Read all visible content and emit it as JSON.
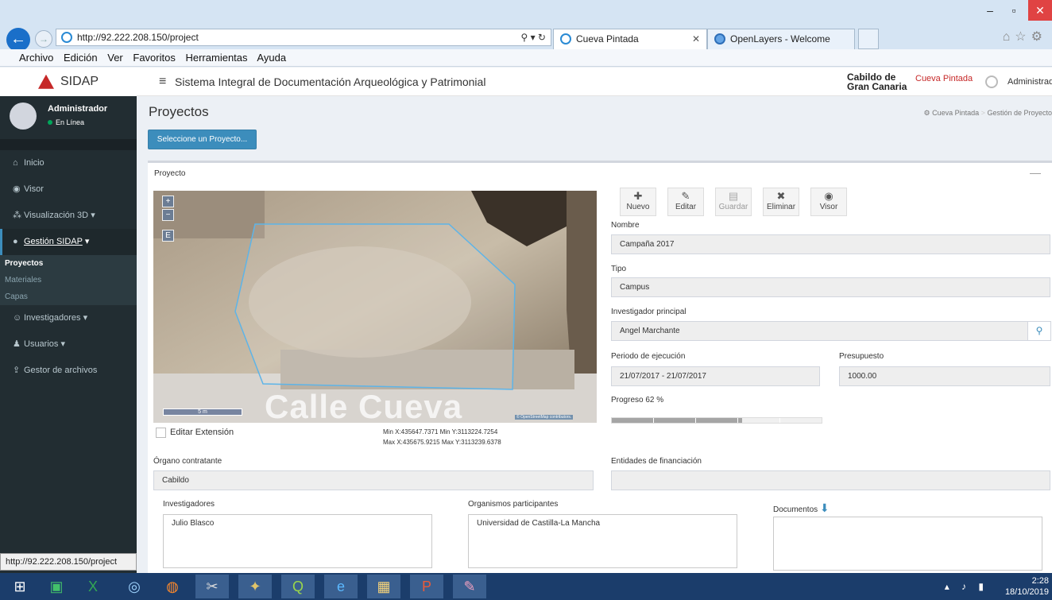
{
  "browser": {
    "url": "http://92.222.208.150/project",
    "tabs": [
      {
        "label": "Cueva Pintada",
        "active": true
      },
      {
        "label": "OpenLayers - Welcome",
        "active": false
      }
    ],
    "menu": [
      "Archivo",
      "Edición",
      "Ver",
      "Favoritos",
      "Herramientas",
      "Ayuda"
    ],
    "status_url": "http://92.222.208.150/project"
  },
  "header": {
    "logo": "SIDAP",
    "title": "Sistema Integral de Documentación Arqueológica y Patrimonial",
    "brand_line1": "Cabildo de",
    "brand_line2": "Gran Canaria",
    "brand_cueva": "Cueva Pintada",
    "user": "Administrad"
  },
  "sidebar": {
    "user_name": "Administrador",
    "user_status": "En Línea",
    "items": [
      {
        "label": "Inicio",
        "icon": "home-icon"
      },
      {
        "label": "Visor",
        "icon": "globe-icon"
      },
      {
        "label": "Visualización 3D",
        "icon": "cubes-icon"
      },
      {
        "label": "Gestión SIDAP",
        "icon": "circle-icon"
      },
      {
        "label": "Investigadores",
        "icon": "users-icon"
      },
      {
        "label": "Usuarios",
        "icon": "user-icon"
      },
      {
        "label": "Gestor de archivos",
        "icon": "upload-icon"
      }
    ],
    "subitems": [
      "Proyectos",
      "Materiales",
      "Capas"
    ]
  },
  "page": {
    "title": "Proyectos",
    "breadcrumb_home": "Cueva Pintada",
    "breadcrumb_current": "Gestión de Proyecto",
    "select_button": "Seleccione un Proyecto...",
    "box_title": "Proyecto",
    "minimize": "—"
  },
  "map": {
    "zoom_in": "+",
    "zoom_out": "−",
    "extent_button": "E",
    "scale": "5 m",
    "street_label": "Calle Cueva",
    "attribution": "© OpenStreetMap contributors.",
    "edit_extent_label": "Editar Extensión",
    "min_line": "Min X:435647.7371 Min Y:3113224.7254",
    "max_line": "Max X:435675.9215 Max Y:3113239.6378"
  },
  "toolbar": {
    "new": "Nuevo",
    "edit": "Editar",
    "save": "Guardar",
    "delete": "Eliminar",
    "viewer": "Visor"
  },
  "form": {
    "name_label": "Nombre",
    "name_value": "Campaña 2017",
    "type_label": "Tipo",
    "type_value": "Campus",
    "pi_label": "Investigador principal",
    "pi_value": "Angel Marchante",
    "period_label": "Periodo de ejecución",
    "period_value": "21/07/2017 - 21/07/2017",
    "budget_label": "Presupuesto",
    "budget_value": "1000.00",
    "progress_label": "Progreso 62 %",
    "progress_fraction": 0.62,
    "org_label": "Órgano contratante",
    "org_value": "Cabildo",
    "funding_label": "Entidades de financiación",
    "funding_value": "",
    "researchers_label": "Investigadores",
    "researchers_value": "Julio Blasco",
    "orgs_label": "Organismos participantes",
    "orgs_value": "Universidad de Castilla-La Mancha",
    "docs_label": "Documentos"
  },
  "taskbar": {
    "time": "2:28",
    "date": "18/10/2019"
  }
}
